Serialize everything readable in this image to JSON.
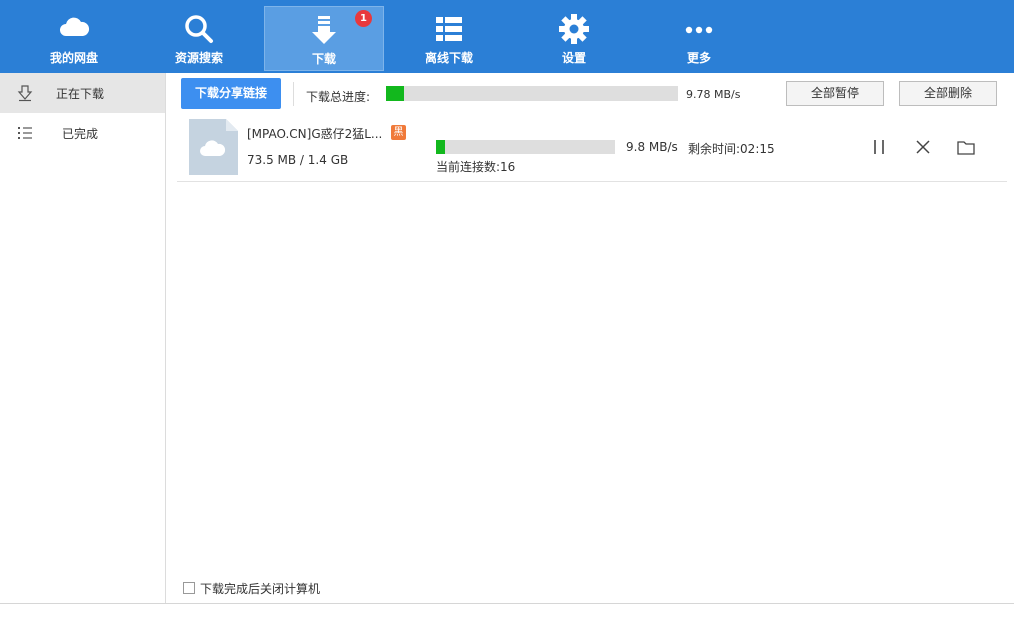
{
  "nav": {
    "items": [
      {
        "label": "我的网盘",
        "icon": "cloud-icon"
      },
      {
        "label": "资源搜索",
        "icon": "search-icon"
      },
      {
        "label": "下载",
        "icon": "download-icon",
        "badge": "1",
        "active": true
      },
      {
        "label": "离线下载",
        "icon": "list-icon"
      },
      {
        "label": "设置",
        "icon": "gear-icon"
      },
      {
        "label": "更多",
        "icon": "more-dots-icon"
      }
    ]
  },
  "sidebar": {
    "items": [
      {
        "label": "正在下载",
        "icon": "download-arrow-icon",
        "active": true
      },
      {
        "label": "已完成",
        "icon": "list-bullets-icon"
      }
    ]
  },
  "toolbar": {
    "share_label": "下载分享链接",
    "total_progress_label": "下载总进度:",
    "total_progress": 0.06,
    "total_speed": "9.78 MB/s",
    "pause_all_label": "全部暂停",
    "delete_all_label": "全部删除"
  },
  "tasks": [
    {
      "name": "[MPAO.CN]G惑仔2猛L...",
      "tag": "黑",
      "size": "73.5 MB / 1.4 GB",
      "progress": 0.05,
      "speed": "9.8 MB/s",
      "remaining": "剩余时间:02:15",
      "connections": "当前连接数:16"
    }
  ],
  "footer": {
    "shutdown_label": "下载完成后关闭计算机",
    "shutdown_checked": false
  },
  "colors": {
    "topbar": "#2b7fd6",
    "accent": "#3d8ff0",
    "progress": "#12b81d",
    "badge": "#e8383d",
    "tag": "#f07a3a"
  }
}
